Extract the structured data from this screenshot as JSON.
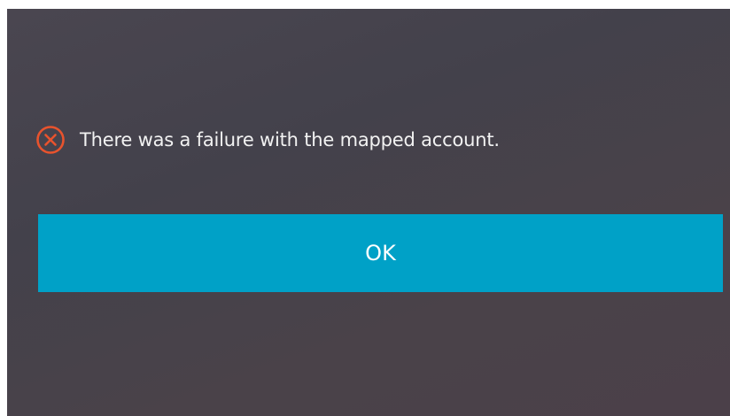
{
  "dialog": {
    "message": "There was a failure with the mapped account.",
    "icon": "error-circle-x-icon",
    "ok_label": "OK"
  },
  "colors": {
    "background": "#46434c",
    "button": "#00a1c7",
    "error_icon": "#e8532d",
    "text": "#f2f2f2"
  }
}
